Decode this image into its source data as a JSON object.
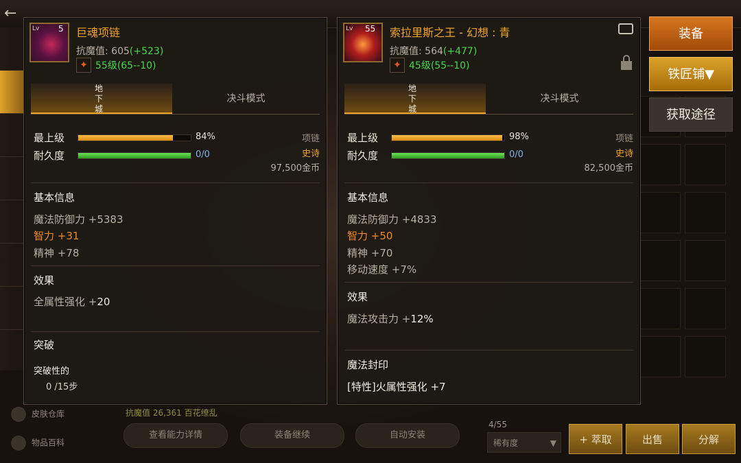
{
  "left_item": {
    "level_prefix": "Lv",
    "level_value": "5",
    "name": "巨魂项链",
    "resist_label": "抗魔值: ",
    "resist_base": "605",
    "resist_bonus": "(+523)",
    "level_range": "55级(65--10)",
    "tabs": {
      "dungeon": "地\n下\n城",
      "duel": "决斗模式"
    },
    "upgrade_label": "最上级",
    "upgrade_pct": "84%",
    "upgrade_value": 84,
    "durability_label": "耐久度",
    "durability_text": "0/0",
    "durability_value": 100,
    "item_type": "项链",
    "rarity": "史诗",
    "price": "97,500金币",
    "basic_title": "基本信息",
    "basic_lines": [
      "魔法防御力 +5383",
      "智力 +31",
      "精神 +78"
    ],
    "effect_title": "效果",
    "effect_line_prefix": "全属性强化 +",
    "effect_line_value": "20",
    "break_title": "突破",
    "break_sub": "突破性的",
    "break_steps": "0  /15步"
  },
  "right_item": {
    "level_prefix": "Lv",
    "level_value": "55",
    "name": "索拉里斯之王 - 幻想 : 青",
    "resist_label": "抗魔值: ",
    "resist_base": "564",
    "resist_bonus": "(+477)",
    "level_range": "45级(55--10)",
    "tabs": {
      "dungeon": "地\n下\n城",
      "duel": "决斗模式"
    },
    "upgrade_label": "最上级",
    "upgrade_pct": "98%",
    "upgrade_value": 98,
    "durability_label": "耐久度",
    "durability_text": "0/0",
    "durability_value": 100,
    "item_type": "项链",
    "rarity": "史诗",
    "price": "82,500金币",
    "basic_title": "基本信息",
    "basic_lines": [
      "魔法防御力 +4833",
      "智力 +50",
      "精神 +70",
      "移动速度 +7%"
    ],
    "effect_title": "效果",
    "effect_line_prefix": "魔法攻击力 +",
    "effect_line_value": "12%",
    "seal_title": "魔法封印",
    "seal_line": "[特性]火属性强化 +7"
  },
  "actions": {
    "equip": "装备",
    "smith": "铁匠铺▼",
    "source": "获取途径"
  },
  "background": {
    "links": [
      "皮肤仓库",
      "物品百科"
    ],
    "pills": [
      "查看能力详情",
      "装备继续",
      "自动安装"
    ],
    "inventory_count": "4/55",
    "sort_label": "稀有度",
    "buttons": [
      "+ 萃取",
      "出售",
      "分解"
    ],
    "stat_text": "抗魔值 26,361  百花缭乱"
  },
  "colors": {
    "rarity_epic": "#f0a329",
    "bonus_green": "#47d647",
    "highlight_orange": "#f08a1e"
  },
  "icons": {
    "back": "arrow-left-icon",
    "share": "share-icon",
    "lock": "lock-icon",
    "rank": "rank-flame-icon"
  }
}
